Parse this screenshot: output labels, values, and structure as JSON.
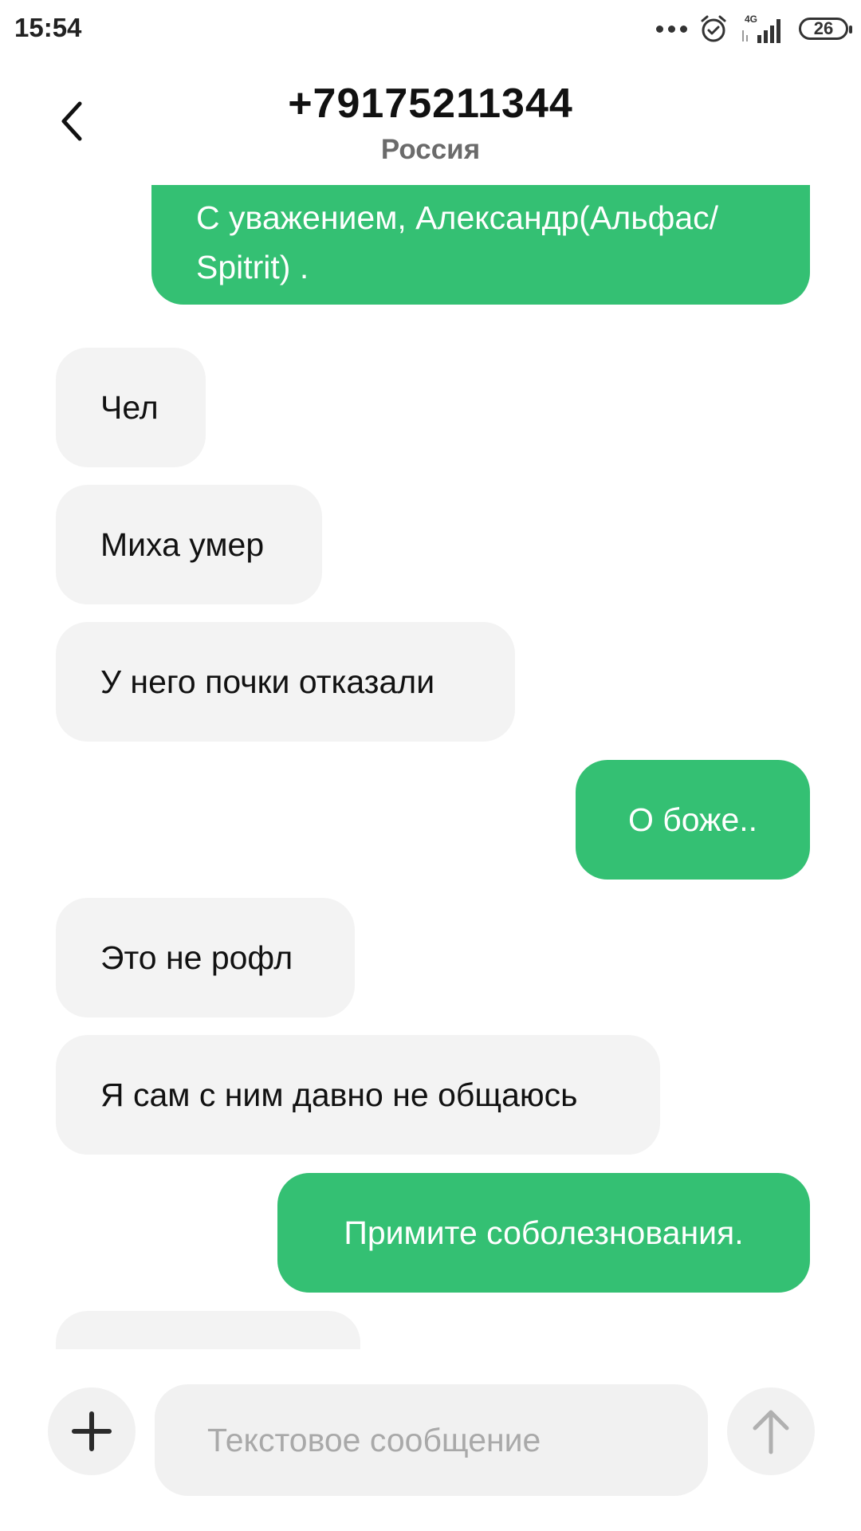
{
  "status_bar": {
    "time": "15:54",
    "network": "4G",
    "battery": "26",
    "icons": [
      "more-dots-icon",
      "alarm-icon",
      "signal-icon",
      "battery-icon"
    ]
  },
  "header": {
    "contact_number": "+79175211344",
    "contact_region": "Россия",
    "back_icon": "chevron-left-icon"
  },
  "messages": [
    {
      "direction": "outgoing",
      "text": "С уважением, Александр(Альфас/ Spitrit) ."
    },
    {
      "direction": "incoming",
      "text": "Чел"
    },
    {
      "direction": "incoming",
      "text": "Миха умер"
    },
    {
      "direction": "incoming",
      "text": "У него почки отказали"
    },
    {
      "direction": "outgoing",
      "text": "О боже.."
    },
    {
      "direction": "incoming",
      "text": "Это не рофл"
    },
    {
      "direction": "incoming",
      "text": "Я сам с ним давно не общаюсь"
    },
    {
      "direction": "outgoing",
      "text": "Примите соболезнования."
    },
    {
      "direction": "incoming",
      "text": ""
    }
  ],
  "compose": {
    "placeholder": "Текстовое сообщение",
    "value": "",
    "attach_icon": "plus-icon",
    "send_icon": "arrow-up-icon"
  },
  "colors": {
    "outgoing_bubble": "#34c073",
    "incoming_bubble": "#f3f3f3",
    "region_text": "#6b6b6b",
    "placeholder_text": "#a9a9a9"
  }
}
